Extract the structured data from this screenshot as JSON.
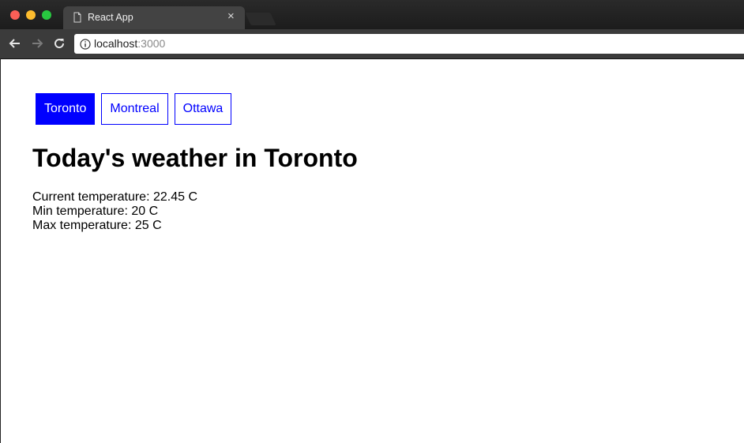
{
  "browser": {
    "tab_title": "React App",
    "tab_close_glyph": "×",
    "url_host": "localhost",
    "url_port": ":3000",
    "icons": [
      "document-icon",
      "back-icon",
      "forward-icon",
      "reload-icon",
      "info-icon",
      "close-icon"
    ]
  },
  "cities": [
    {
      "label": "Toronto",
      "active": true
    },
    {
      "label": "Montreal",
      "active": false
    },
    {
      "label": "Ottawa",
      "active": false
    }
  ],
  "weather": {
    "heading": "Today's weather in Toronto",
    "current": "Current temperature: 22.45 C",
    "min": "Min temperature: 20 C",
    "max": "Max temperature: 25 C"
  },
  "colors": {
    "accent": "#0000ff",
    "active_text": "#ffffff"
  }
}
